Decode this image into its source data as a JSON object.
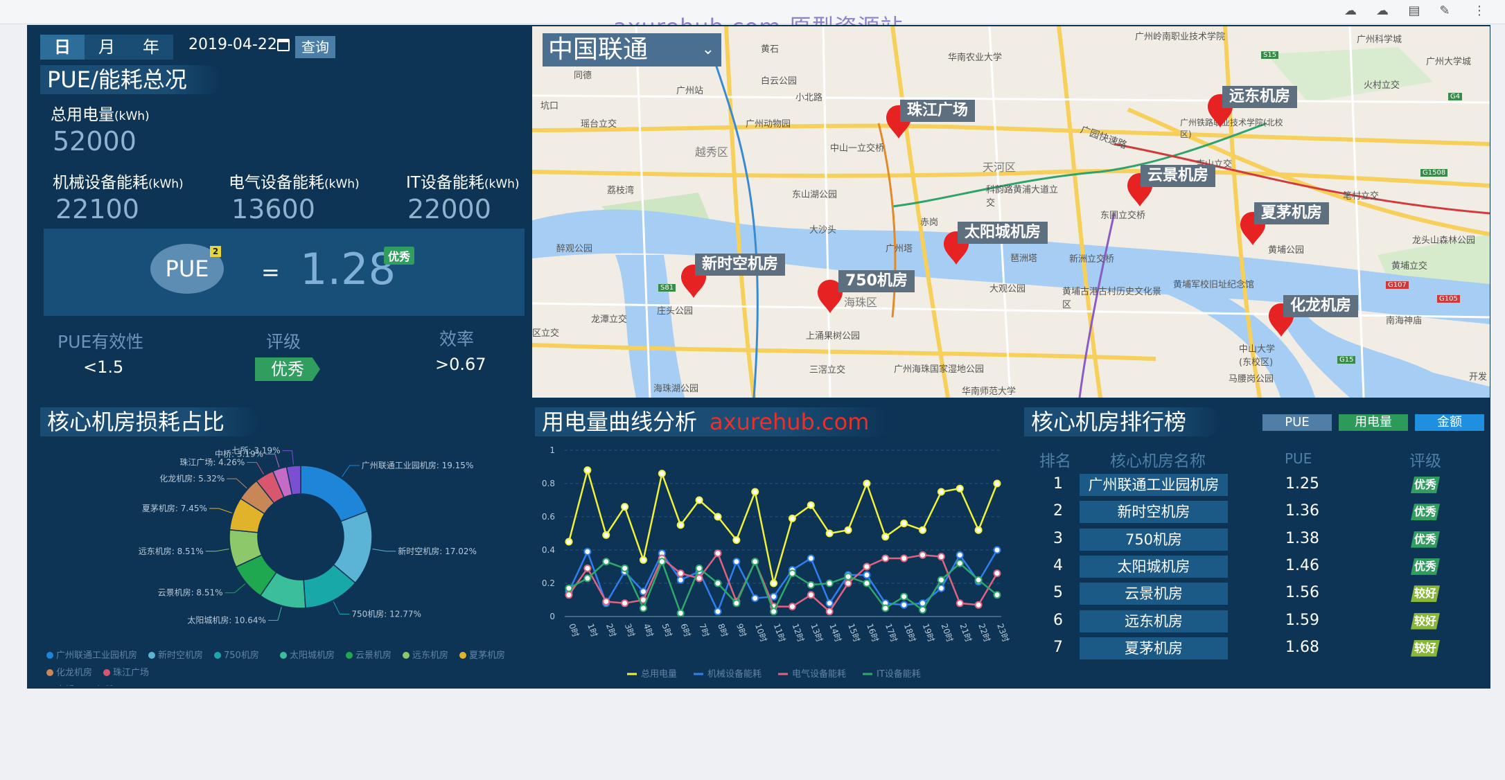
{
  "watermark": "axurehub.com 原型资源站",
  "browser_icons": [
    "cloud-upload-icon",
    "cloud-download-icon",
    "document-icon",
    "edit-icon",
    "more-icon"
  ],
  "date_filter": {
    "tabs": [
      "日",
      "月",
      "年"
    ],
    "active": "日",
    "date": "2019-04-22",
    "query_label": "查询"
  },
  "overview": {
    "title": "PUE/能耗总况",
    "total_label": "总用电量",
    "unit": "(kWh)",
    "total_value": "52000",
    "mech_label": "机械设备能耗",
    "mech_value": "22100",
    "elec_label": "电气设备能耗",
    "elec_value": "13600",
    "it_label": "IT设备能耗",
    "it_value": "22000",
    "pue_label": "PUE",
    "pue_sup": "2",
    "pue_eq": "=",
    "pue_value": "1.28",
    "pue_badge": "优秀",
    "eff_label": "PUE有效性",
    "eff_value": "<1.5",
    "rating_label": "评级",
    "rating_value": "优秀",
    "ratio_label": "效率",
    "ratio_value": ">0.67"
  },
  "map": {
    "operator": "中国联通",
    "sites": [
      "珠江广场",
      "远东机房",
      "云景机房",
      "夏茅机房",
      "太阳城机房",
      "新时空机房",
      "750机房",
      "化龙机房"
    ],
    "place_labels": [
      "越秀区",
      "天河区",
      "海珠区",
      "广州塔",
      "白云公园",
      "中山一立交桥",
      "东山湖公园",
      "广州动物园",
      "华南农业大学",
      "科韵路黄浦大道立交",
      "东圃立交桥",
      "新洲立交桥",
      "黄埔古港古村历史文化景区",
      "黄埔军校旧址纪念馆",
      "中山大学(东校区)",
      "上涌果树公园",
      "龙潭立交",
      "庄头公园",
      "大沙头",
      "醉观公园",
      "荔枝湾",
      "广州站",
      "黄埔立交",
      "开发",
      "龙头山森林公园",
      "南海神庙",
      "马腰岗公园",
      "广州海珠国家湿地公园",
      "三滘立交",
      "华南师范大学",
      "广州岭南职业技术学院",
      "广州科学城",
      "广州大学城",
      "火村立交",
      "广州铁路职业技术学院(北校区)",
      "吉山立交",
      "笔村立交",
      "黄埔公园",
      "大观公园",
      "区立交",
      "琶洲塔",
      "赤岗",
      "海珠湖公园",
      "瑶台立交",
      "广园快速路",
      "小北路",
      "同德",
      "黄石",
      "坑口"
    ],
    "road_labels": [
      "S15",
      "G4",
      "G1508",
      "G107",
      "S81",
      "G105",
      "G15"
    ]
  },
  "loss_chart_title": "核心机房损耗占比",
  "curve_title": "用电量曲线分析",
  "curve_watermark": "axurehub.com",
  "rank": {
    "title": "核心机房排行榜",
    "tabs": [
      "PUE",
      "用电量",
      "金额"
    ],
    "headers": {
      "rank": "排名",
      "name": "核心机房名称",
      "pue": "PUE",
      "grade": "评级"
    },
    "rows": [
      {
        "n": "1",
        "name": "广州联通工业园机房",
        "pue": "1.25",
        "grade": "优秀"
      },
      {
        "n": "2",
        "name": "新时空机房",
        "pue": "1.36",
        "grade": "优秀"
      },
      {
        "n": "3",
        "name": "750机房",
        "pue": "1.38",
        "grade": "优秀"
      },
      {
        "n": "4",
        "name": "太阳城机房",
        "pue": "1.46",
        "grade": "优秀"
      },
      {
        "n": "5",
        "name": "云景机房",
        "pue": "1.56",
        "grade": "较好"
      },
      {
        "n": "6",
        "name": "远东机房",
        "pue": "1.59",
        "grade": "较好"
      },
      {
        "n": "7",
        "name": "夏茅机房",
        "pue": "1.68",
        "grade": "较好"
      }
    ]
  },
  "colors": {
    "excellent": "#2f9e5f",
    "good": "#8ab73a"
  },
  "chart_data": [
    {
      "type": "pie",
      "title": "核心机房损耗占比",
      "slices": [
        {
          "name": "广州联通工业园机房",
          "value": 19.15,
          "label": "广州联通工业园机房: 19.15%",
          "color": "#1e86d9"
        },
        {
          "name": "新时空机房",
          "value": 17.02,
          "label": "新时空机房: 17.02%",
          "color": "#5bb3d6"
        },
        {
          "name": "750机房",
          "value": 12.77,
          "label": "750机房: 12.77%",
          "color": "#18a8a8"
        },
        {
          "name": "太阳城机房",
          "value": 10.64,
          "label": "太阳城机房: 10.64%",
          "color": "#3bbf9b"
        },
        {
          "name": "云景机房",
          "value": 8.51,
          "label": "云景机房: 8.51%",
          "color": "#1fa84f"
        },
        {
          "name": "远东机房",
          "value": 8.51,
          "label": "远东机房: 8.51%",
          "color": "#8dc86a"
        },
        {
          "name": "夏茅机房",
          "value": 7.45,
          "label": "夏茅机房: 7.45%",
          "color": "#e0b32a"
        },
        {
          "name": "化龙机房",
          "value": 5.32,
          "label": "化龙机房: 5.32%",
          "color": "#c98657"
        },
        {
          "name": "珠江广场",
          "value": 4.26,
          "label": "珠江广场: 4.26%",
          "color": "#d8576e"
        },
        {
          "name": "中桥",
          "value": 3.19,
          "label": "中桥: 3.19%",
          "color": "#c36bc5"
        },
        {
          "name": "七所",
          "value": 3.19,
          "label": "七所: 3.19%",
          "color": "#7b4fd1"
        }
      ],
      "legend_position": "bottom"
    },
    {
      "type": "line",
      "title": "用电量曲线分析",
      "x": [
        "0时",
        "1时",
        "2时",
        "3时",
        "4时",
        "5时",
        "6时",
        "7时",
        "8时",
        "9时",
        "10时",
        "11时",
        "12时",
        "13时",
        "14时",
        "15时",
        "16时",
        "17时",
        "18时",
        "19时",
        "20时",
        "21时",
        "22时",
        "23时"
      ],
      "ylim": [
        0,
        1
      ],
      "yticks": [
        "0",
        "0.2",
        "0.4",
        "0.6",
        "0.8",
        "1"
      ],
      "series": [
        {
          "name": "总用电量",
          "color": "#f2f23a",
          "values": [
            0.45,
            0.88,
            0.49,
            0.66,
            0.34,
            0.86,
            0.55,
            0.7,
            0.6,
            0.46,
            0.75,
            0.2,
            0.59,
            0.67,
            0.5,
            0.52,
            0.8,
            0.48,
            0.56,
            0.52,
            0.75,
            0.77,
            0.52,
            0.8
          ]
        },
        {
          "name": "机械设备能耗",
          "color": "#2e7ff0",
          "values": [
            0.15,
            0.39,
            0.08,
            0.27,
            0.15,
            0.38,
            0.22,
            0.27,
            0.03,
            0.33,
            0.11,
            0.12,
            0.28,
            0.35,
            0.08,
            0.25,
            0.25,
            0.08,
            0.07,
            0.08,
            0.17,
            0.37,
            0.21,
            0.4
          ]
        },
        {
          "name": "电气设备能耗",
          "color": "#e0637f",
          "values": [
            0.13,
            0.29,
            0.09,
            0.08,
            0.1,
            0.35,
            0.26,
            0.23,
            0.38,
            0.09,
            0.33,
            0.06,
            0.06,
            0.13,
            0.03,
            0.2,
            0.3,
            0.35,
            0.35,
            0.37,
            0.36,
            0.08,
            0.07,
            0.26
          ]
        },
        {
          "name": "IT设备能耗",
          "color": "#2fa86a",
          "values": [
            0.17,
            0.23,
            0.33,
            0.29,
            0.05,
            0.33,
            0.02,
            0.29,
            0.2,
            0.08,
            0.33,
            0.03,
            0.26,
            0.19,
            0.2,
            0.24,
            0.2,
            0.05,
            0.12,
            0.04,
            0.22,
            0.32,
            0.22,
            0.13
          ]
        }
      ],
      "legend_position": "bottom"
    }
  ]
}
